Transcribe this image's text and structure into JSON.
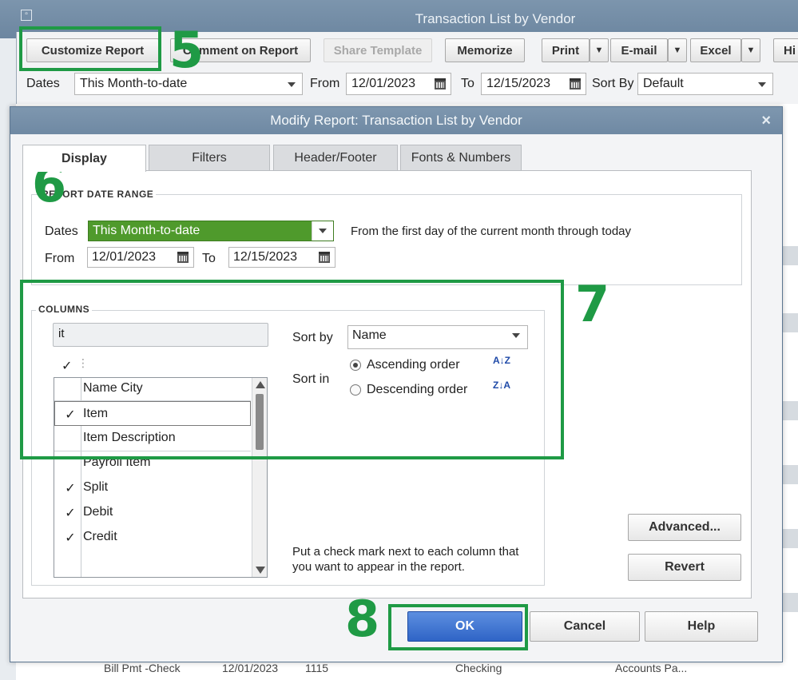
{
  "window": {
    "title": "Transaction List by Vendor"
  },
  "toolbar": {
    "customize_report": "Customize Report",
    "comment_on_report": "Comment on Report",
    "share_template": "Share Template",
    "memorize": "Memorize",
    "print": "Print",
    "email": "E-mail",
    "excel": "Excel",
    "hide": "Hi"
  },
  "filters": {
    "dates_label": "Dates",
    "dates_value": "This Month-to-date",
    "from_label": "From",
    "from_value": "12/01/2023",
    "to_label": "To",
    "to_value": "12/15/2023",
    "sort_by_label": "Sort By",
    "sort_by_value": "Default"
  },
  "dialog": {
    "title": "Modify Report: Transaction List by Vendor",
    "close_glyph": "×",
    "tabs": [
      "Display",
      "Filters",
      "Header/Footer",
      "Fonts & Numbers"
    ],
    "date_range": {
      "title": "REPORT DATE RANGE",
      "dates_label": "Dates",
      "dates_value": "This Month-to-date",
      "description": "From the first day of the current month through today",
      "from_label": "From",
      "from_value": "12/01/2023",
      "to_label": "To",
      "to_value": "12/15/2023"
    },
    "columns": {
      "title": "COLUMNS",
      "search_value": "it",
      "header_check": "✓",
      "header_dots": "⋮",
      "items": [
        {
          "label": "Name City",
          "checked": ""
        },
        {
          "label": "Item",
          "checked": "✓"
        },
        {
          "label": "Item Description",
          "checked": ""
        },
        {
          "label": "Payroll Item",
          "checked": ""
        },
        {
          "label": "Split",
          "checked": "✓"
        },
        {
          "label": "Debit",
          "checked": "✓"
        },
        {
          "label": "Credit",
          "checked": "✓"
        }
      ],
      "sort_by_label": "Sort by",
      "sort_by_value": "Name",
      "sort_in_label": "Sort in",
      "ascending": "Ascending order",
      "descending": "Descending order",
      "asc_icon": "A↓Z",
      "desc_icon": "Z↓A",
      "hint": "Put a check mark next to each column that you want to appear in the report."
    },
    "advanced": "Advanced...",
    "revert": "Revert",
    "ok": "OK",
    "cancel": "Cancel",
    "help": "Help"
  },
  "report_row": {
    "type": "Bill Pmt -Check",
    "date": "12/01/2023",
    "num": "1115",
    "account": "Checking",
    "split": "Accounts Pa..."
  },
  "steps": [
    "5",
    "6",
    "7",
    "8"
  ],
  "colors": {
    "highlight": "#1f9a45",
    "accent": "#2f64c6",
    "dates_green": "#4f9a2c"
  }
}
